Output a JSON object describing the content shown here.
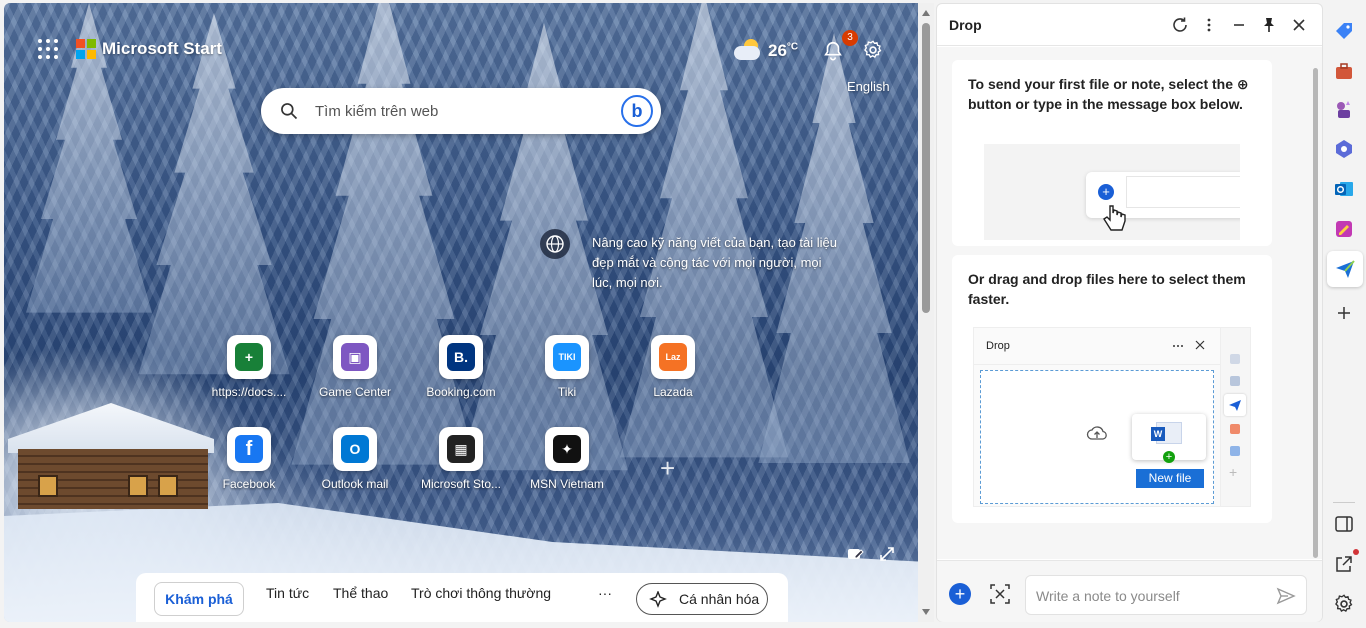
{
  "header": {
    "brand": "Microsoft Start",
    "temperature": "26",
    "temp_unit": "°C",
    "notification_count": "3",
    "language": "English"
  },
  "search": {
    "placeholder": "Tìm kiếm trên web",
    "bing_glyph": "b"
  },
  "promo": {
    "text": "Nâng cao kỹ năng viết của bạn, tạo tài liệu đẹp mắt và cộng tác với mọi người, mọi lúc, mọi nơi."
  },
  "tiles": [
    {
      "label": "https://docs....",
      "glyph": "+",
      "color": "#188038"
    },
    {
      "label": "Game Center",
      "glyph": "▣",
      "color": "#7e57c2"
    },
    {
      "label": "Booking.com",
      "glyph": "B.",
      "color": "#003580"
    },
    {
      "label": "Tiki",
      "glyph": "TIKI",
      "color": "#1a94ff"
    },
    {
      "label": "Lazada",
      "glyph": "Laz",
      "color": "#f57224"
    },
    {
      "label": "Facebook",
      "glyph": "f",
      "color": "#1877f2"
    },
    {
      "label": "Outlook mail",
      "glyph": "O",
      "color": "#0078d4"
    },
    {
      "label": "Microsoft Sto...",
      "glyph": "▦",
      "color": "#222222"
    },
    {
      "label": "MSN Vietnam",
      "glyph": "✦",
      "color": "#111111"
    }
  ],
  "bottom_tabs": {
    "active": "Khám phá",
    "tab2": "Tin tức",
    "tab3": "Thể thao",
    "tab4": "Trò chơi thông thường",
    "more": "···",
    "personalize": "Cá nhân hóa"
  },
  "drop": {
    "title": "Drop",
    "card1_text": "To send your first file or note, select the ⊕ button or type in the message box below.",
    "card2_text": "Or drag and drop files here to select them faster.",
    "mini_title": "Drop",
    "new_file_label": "New file",
    "note_placeholder": "Write a note to yourself"
  },
  "colors": {
    "accent": "#1a5fd6",
    "badge": "#d83b01"
  }
}
